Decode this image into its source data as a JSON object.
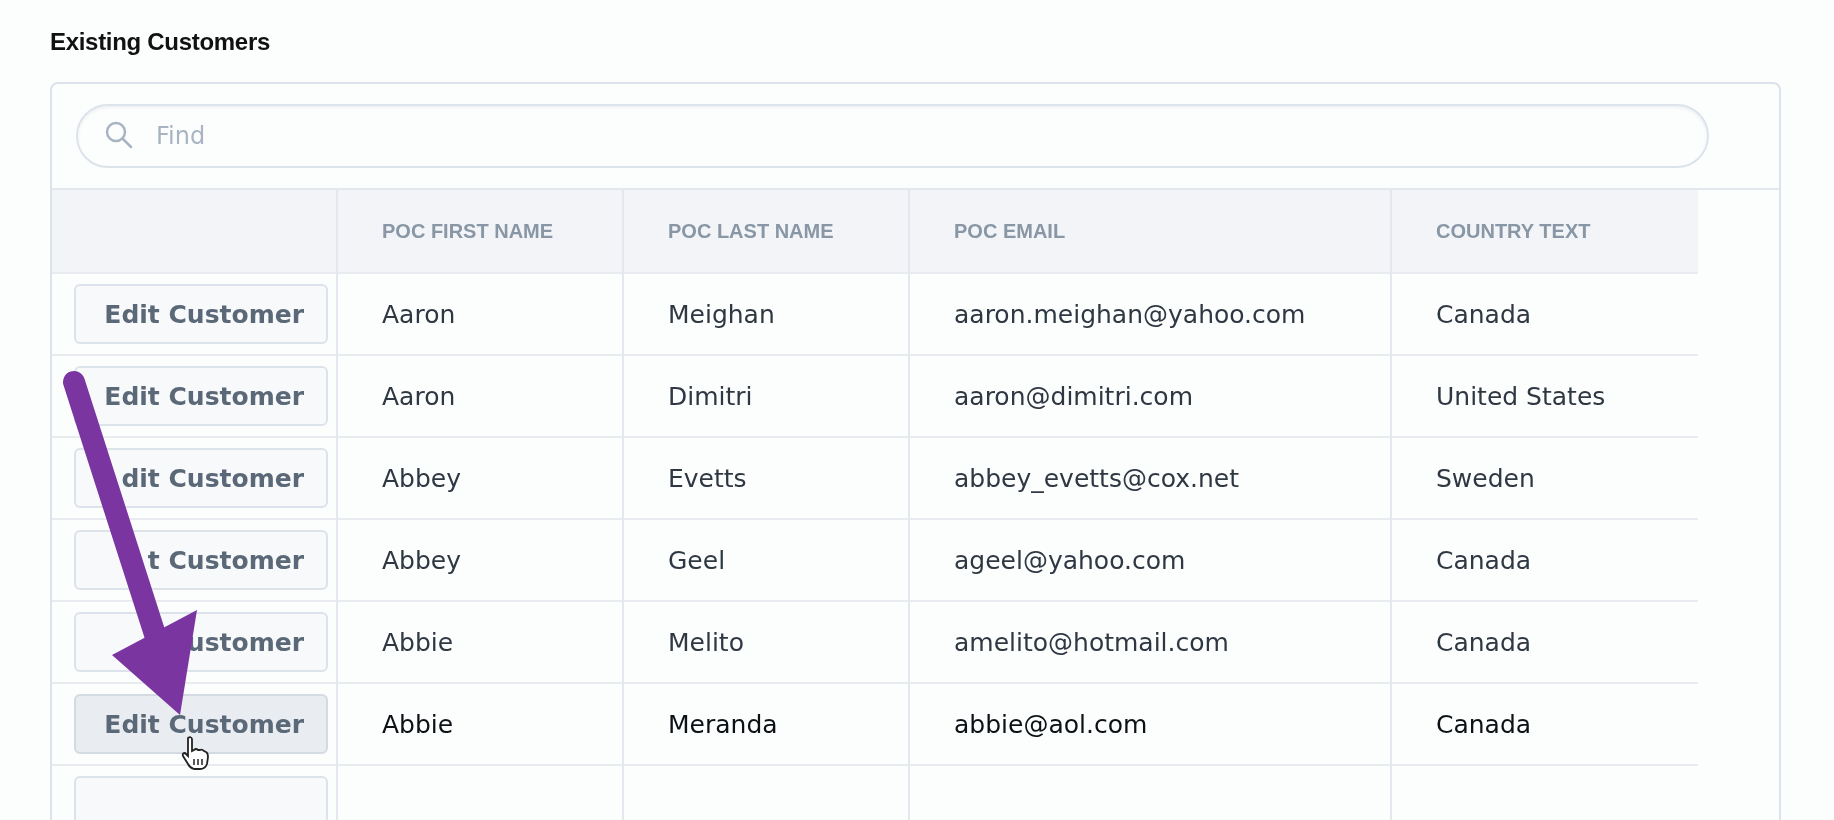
{
  "title": "Existing Customers",
  "search": {
    "placeholder": "Find"
  },
  "table": {
    "columns": [
      "",
      "POC FIRST NAME",
      "POC LAST NAME",
      "POC EMAIL",
      "COUNTRY TEXT"
    ],
    "rows": [
      {
        "hovered": false,
        "cells": [
          "Edit Customer",
          "Aaron",
          "Meighan",
          "aaron.meighan@yahoo.com",
          "Canada"
        ]
      },
      {
        "hovered": false,
        "cells": [
          "Edit Customer",
          "Aaron",
          "Dimitri",
          "aaron@dimitri.com",
          "United States"
        ]
      },
      {
        "hovered": false,
        "cells": [
          "dit Customer",
          "Abbey",
          "Evetts",
          "abbey_evetts@cox.net",
          "Sweden"
        ]
      },
      {
        "hovered": false,
        "cells": [
          "t Customer",
          "Abbey",
          "Geel",
          "ageel@yahoo.com",
          "Canada"
        ]
      },
      {
        "hovered": false,
        "cells": [
          "ustomer",
          "Abbie",
          "Melito",
          "amelito@hotmail.com",
          "Canada"
        ]
      },
      {
        "hovered": true,
        "cells": [
          "Edit Customer",
          "Abbie",
          "Meranda",
          "abbie@aol.com",
          "Canada"
        ]
      }
    ]
  }
}
